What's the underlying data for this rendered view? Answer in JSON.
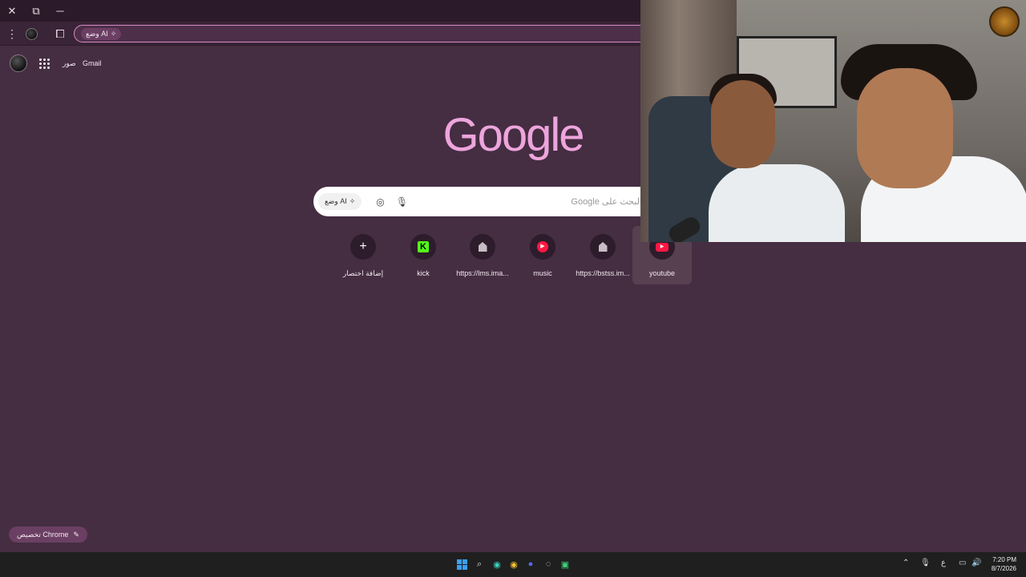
{
  "browser": {
    "omnibox": {
      "ai_mode_label": "وضع AI"
    }
  },
  "page": {
    "top_links": {
      "gmail": "Gmail",
      "images": "صور"
    },
    "logo_text": "Google",
    "search": {
      "placeholder": "البحث على Google",
      "ai_mode_label": "وضع AI"
    },
    "shortcuts": [
      {
        "label": "إضافة اختصار",
        "icon": "plus-icon"
      },
      {
        "label": "kick",
        "icon": "kick-icon"
      },
      {
        "label": "https://lms.ima...",
        "icon": "home-icon"
      },
      {
        "label": "music",
        "icon": "youtube-music-icon"
      },
      {
        "label": "https://bstss.im...",
        "icon": "home-icon"
      },
      {
        "label": "youtube",
        "icon": "youtube-icon"
      }
    ],
    "customize_label": "تخصيص Chrome"
  },
  "taskbar": {
    "language": "ع",
    "time": "7:20 PM",
    "date": "8/7/2026"
  },
  "colors": {
    "background": "#452d42",
    "accent": "#eda5dc",
    "chip": "#6b3f63"
  }
}
